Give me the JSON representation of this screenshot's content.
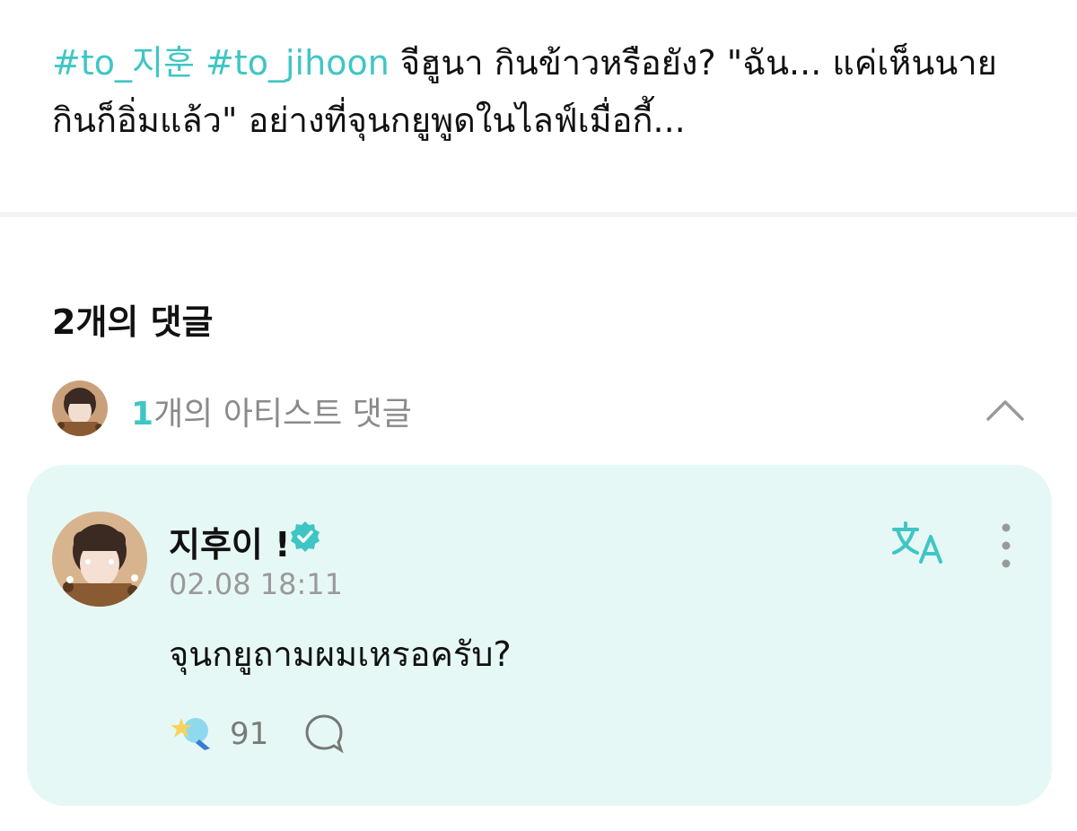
{
  "post": {
    "tag1": "#to_지훈",
    "tag2": "#to_jihoon",
    "text": " จีฮูนา กินข้าวหรือยัง? \"ฉัน... แค่เห็นนายกินก็อิ่มแล้ว\" อย่างที่จุนกยูพูดในไลฟ์เมื่อกี้..."
  },
  "comments": {
    "title": "2개의 댓글",
    "artist_count": "1",
    "artist_label": "개의 아티스트 댓글"
  },
  "comment": {
    "username": "지후이 !",
    "timestamp": "02.08 18:11",
    "body": "จุนกยูถามผมเหรอครับ?",
    "reaction_count": "91"
  },
  "icons": {
    "verified": "verified-badge-icon",
    "translate": "translate-icon",
    "more": "more-vertical-icon",
    "reaction": "star-reaction-icon",
    "reply": "reply-bubble-icon",
    "collapse": "chevron-up-icon"
  },
  "colors": {
    "accent": "#3fc6c4",
    "card_bg": "#e6f8f5"
  }
}
